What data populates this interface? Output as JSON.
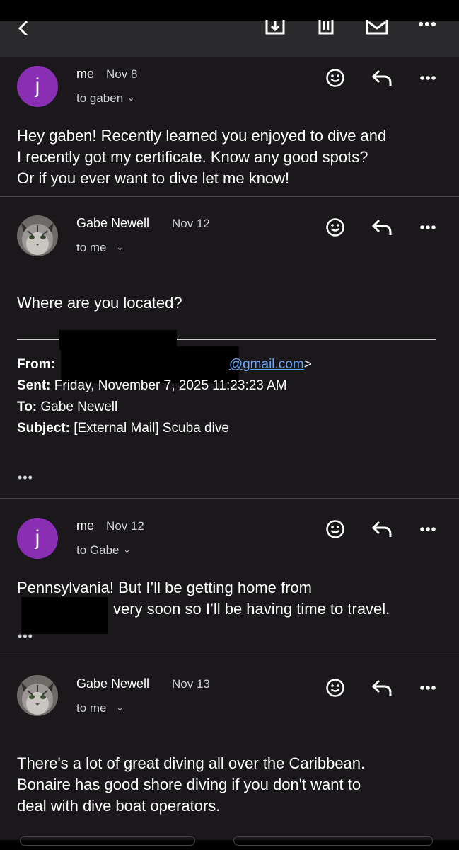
{
  "toolbar": {
    "back_icon": "chevron-left-icon",
    "download_icon": "archive-download-icon",
    "trash_icon": "trash-icon",
    "mail_icon": "mail-icon",
    "more_icon": "more-icon"
  },
  "messages": [
    {
      "avatar_letter": "j",
      "sender": "me",
      "date": "Nov 8",
      "to": "to gaben",
      "body": [
        "Hey gaben! Recently learned you enjoyed to dive and",
        "I recently got my certificate. Know any good spots?",
        "Or if you ever want to dive let me know!"
      ]
    },
    {
      "sender": "Gabe Newell",
      "date": "Nov 12",
      "to": "to me",
      "body": [
        "Where are you located?"
      ],
      "quoted": {
        "from_label": "From:",
        "from_value": "@gmail.com",
        "from_suffix": ">",
        "sent_label": "Sent:",
        "sent_value": "Friday, November 7, 2025 11:23:23 AM",
        "to_label": "To:",
        "to_value": "Gabe Newell",
        "subject_label": "Subject:",
        "subject_value": "[External Mail] Scuba dive"
      },
      "ellipsis": "•••"
    },
    {
      "avatar_letter": "j",
      "sender": "me",
      "date": "Nov 12",
      "to": "to Gabe",
      "body": [
        "Pennsylvania! But I’ll be getting home from",
        "very soon so I’ll be having time to travel."
      ],
      "ellipsis": "•••"
    },
    {
      "sender": "Gabe Newell",
      "date": "Nov 13",
      "to": "to me",
      "body": [
        "There's a lot of great diving all over the Caribbean.",
        "Bonaire has good shore diving if you don't want to",
        "deal with dive boat operators."
      ]
    }
  ],
  "colors": {
    "background": "#1b181c",
    "toolbar": "#2a292b",
    "avatar_purple": "#8a2eb4",
    "link": "#6aa7ff"
  }
}
